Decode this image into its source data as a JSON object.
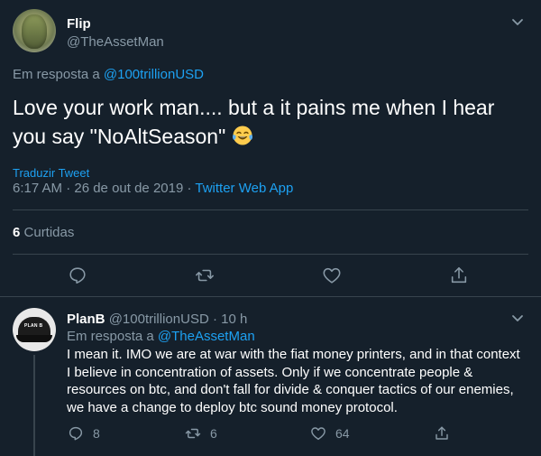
{
  "main_tweet": {
    "display_name": "Flip",
    "handle": "@TheAssetMan",
    "reply_prefix": "Em resposta a",
    "reply_target": "@100trillionUSD",
    "text": "Love your work man.... but a it pains me when I hear you say \"NoAltSeason\"",
    "emoji": "face-with-tears-of-joy",
    "translate_label": "Traduzir Tweet",
    "timestamp": "6:17 AM · 26 de out de 2019 · ",
    "source": "Twitter Web App",
    "likes_count": "6",
    "likes_label": "Curtidas"
  },
  "reply": {
    "display_name": "PlanB",
    "handle": "@100trillionUSD",
    "time": "· 10 h",
    "reply_prefix": "Em resposta a",
    "reply_target": "@TheAssetMan",
    "avatar_logo": "PLAN B",
    "text": "I mean it. IMO we are at war with the fiat money printers, and in that context I believe in concentration of assets. Only if we concentrate people & resources on btc, and don't fall for divide & conquer tactics of our enemies, we have a change to deploy btc sound money protocol.",
    "reply_count": "8",
    "retweet_count": "6",
    "like_count": "64"
  },
  "colors": {
    "background": "#15202b",
    "text_primary": "#ffffff",
    "text_secondary": "#8899a6",
    "accent": "#1da1f2",
    "divider": "#38444d"
  }
}
